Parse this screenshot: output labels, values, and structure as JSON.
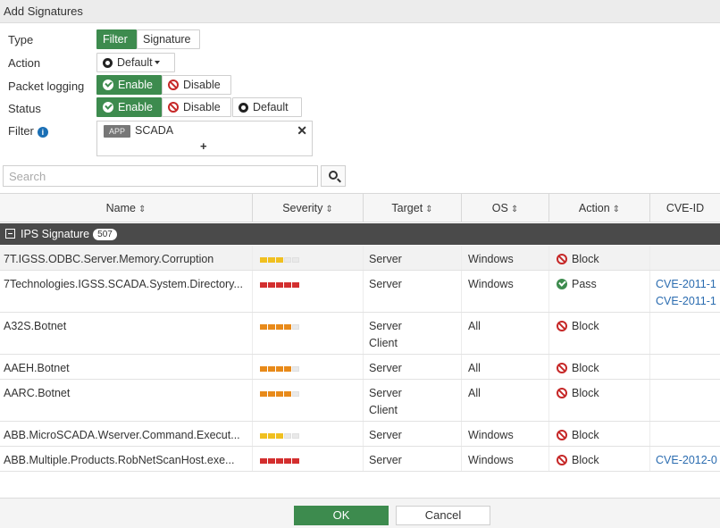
{
  "dialog": {
    "title": "Add Signatures"
  },
  "form": {
    "type": {
      "label": "Type",
      "options": [
        "Filter",
        "Signature"
      ],
      "selected": "Filter"
    },
    "action": {
      "label": "Action",
      "value": "Default"
    },
    "packet_logging": {
      "label": "Packet logging",
      "options": [
        "Enable",
        "Disable"
      ],
      "selected": "Enable"
    },
    "status": {
      "label": "Status",
      "options": [
        "Enable",
        "Disable",
        "Default"
      ],
      "selected": "Enable"
    },
    "filter": {
      "label": "Filter",
      "tag": "APP",
      "value": "SCADA",
      "remove_glyph": "✕",
      "add_glyph": "+"
    }
  },
  "search": {
    "placeholder": "Search",
    "value": ""
  },
  "table": {
    "columns": [
      "Name",
      "Severity",
      "Target",
      "OS",
      "Action",
      "CVE-ID"
    ],
    "sort_glyph": "⇕",
    "group": {
      "label": "IPS Signature",
      "count": "507"
    },
    "rows": [
      {
        "name": "7T.IGSS.ODBC.Server.Memory.Corruption",
        "severity_level": 3,
        "severity_color": "#f0c020",
        "target": [
          "Server"
        ],
        "os": "Windows",
        "action": "Block",
        "action_kind": "block",
        "cve": []
      },
      {
        "name": "7Technologies.IGSS.SCADA.System.Directory...",
        "severity_level": 5,
        "severity_color": "#d32f2f",
        "target": [
          "Server"
        ],
        "os": "Windows",
        "action": "Pass",
        "action_kind": "pass",
        "cve": [
          "CVE-2011-1",
          "CVE-2011-1"
        ]
      },
      {
        "name": "A32S.Botnet",
        "severity_level": 4,
        "severity_color": "#e88a1a",
        "target": [
          "Server",
          "Client"
        ],
        "os": "All",
        "action": "Block",
        "action_kind": "block",
        "cve": []
      },
      {
        "name": "AAEH.Botnet",
        "severity_level": 4,
        "severity_color": "#e88a1a",
        "target": [
          "Server"
        ],
        "os": "All",
        "action": "Block",
        "action_kind": "block",
        "cve": []
      },
      {
        "name": "AARC.Botnet",
        "severity_level": 4,
        "severity_color": "#e88a1a",
        "target": [
          "Server",
          "Client"
        ],
        "os": "All",
        "action": "Block",
        "action_kind": "block",
        "cve": []
      },
      {
        "name": "ABB.MicroSCADA.Wserver.Command.Execut...",
        "severity_level": 3,
        "severity_color": "#f0c020",
        "target": [
          "Server"
        ],
        "os": "Windows",
        "action": "Block",
        "action_kind": "block",
        "cve": []
      },
      {
        "name": "ABB.Multiple.Products.RobNetScanHost.exe...",
        "severity_level": 5,
        "severity_color": "#d32f2f",
        "target": [
          "Server"
        ],
        "os": "Windows",
        "action": "Block",
        "action_kind": "block",
        "cve": [
          "CVE-2012-0"
        ]
      }
    ]
  },
  "footer": {
    "ok_label": "OK",
    "cancel_label": "Cancel"
  }
}
